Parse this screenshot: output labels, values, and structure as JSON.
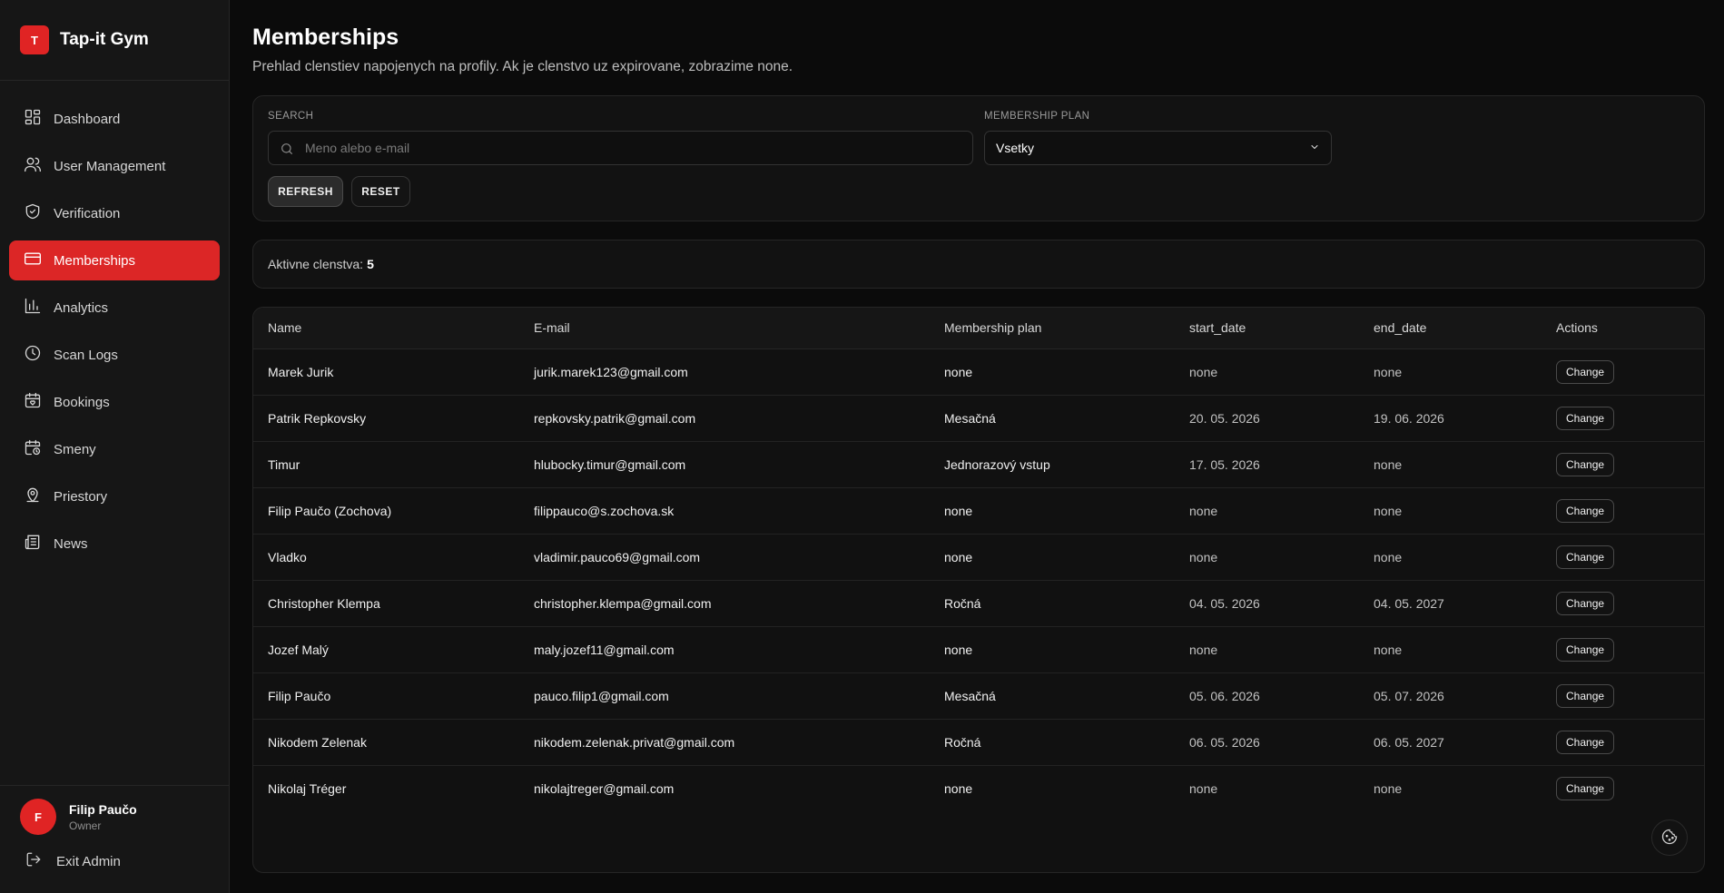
{
  "brand": {
    "logo_letter": "T",
    "name": "Tap-it Gym",
    "accent": "#dc2626"
  },
  "nav": [
    {
      "label": "Dashboard",
      "icon": "dashboard-icon"
    },
    {
      "label": "User Management",
      "icon": "users-icon"
    },
    {
      "label": "Verification",
      "icon": "shield-check-icon"
    },
    {
      "label": "Memberships",
      "icon": "credit-card-icon",
      "active": true
    },
    {
      "label": "Analytics",
      "icon": "bar-chart-icon"
    },
    {
      "label": "Scan Logs",
      "icon": "clock-icon"
    },
    {
      "label": "Bookings",
      "icon": "calendar-heart-icon"
    },
    {
      "label": "Smeny",
      "icon": "calendar-clock-icon"
    },
    {
      "label": "Priestory",
      "icon": "map-pin-icon"
    },
    {
      "label": "News",
      "icon": "newspaper-icon"
    }
  ],
  "user": {
    "avatar_letter": "F",
    "name": "Filip Paučo",
    "role": "Owner"
  },
  "exit_label": "Exit Admin",
  "page": {
    "title": "Memberships",
    "subtitle": "Prehlad clenstiev napojenych na profily. Ak je clenstvo uz expirovane, zobrazime none."
  },
  "filters": {
    "search_label": "SEARCH",
    "search_placeholder": "Meno alebo e-mail",
    "search_value": "",
    "plan_label": "MEMBERSHIP PLAN",
    "plan_value": "Vsetky",
    "refresh_label": "REFRESH",
    "reset_label": "RESET"
  },
  "stats": {
    "label": "Aktivne clenstva:",
    "value": "5"
  },
  "table": {
    "columns": [
      "Name",
      "E-mail",
      "Membership plan",
      "start_date",
      "end_date",
      "Actions"
    ],
    "action_label": "Change",
    "rows": [
      {
        "name": "Marek Jurik",
        "email": "jurik.marek123@gmail.com",
        "plan": "none",
        "start": "none",
        "end": "none"
      },
      {
        "name": "Patrik Repkovsky",
        "email": "repkovsky.patrik@gmail.com",
        "plan": "Mesačná",
        "start": "20. 05. 2026",
        "end": "19. 06. 2026"
      },
      {
        "name": "Timur",
        "email": "hlubocky.timur@gmail.com",
        "plan": "Jednorazový vstup",
        "start": "17. 05. 2026",
        "end": "none"
      },
      {
        "name": "Filip Paučo (Zochova)",
        "email": "filippauco@s.zochova.sk",
        "plan": "none",
        "start": "none",
        "end": "none"
      },
      {
        "name": "Vladko",
        "email": "vladimir.pauco69@gmail.com",
        "plan": "none",
        "start": "none",
        "end": "none"
      },
      {
        "name": "Christopher Klempa",
        "email": "christopher.klempa@gmail.com",
        "plan": "Ročná",
        "start": "04. 05. 2026",
        "end": "04. 05. 2027"
      },
      {
        "name": "Jozef Malý",
        "email": "maly.jozef11@gmail.com",
        "plan": "none",
        "start": "none",
        "end": "none"
      },
      {
        "name": "Filip Paučo",
        "email": "pauco.filip1@gmail.com",
        "plan": "Mesačná",
        "start": "05. 06. 2026",
        "end": "05. 07. 2026"
      },
      {
        "name": "Nikodem Zelenak",
        "email": "nikodem.zelenak.privat@gmail.com",
        "plan": "Ročná",
        "start": "06. 05. 2026",
        "end": "06. 05. 2027"
      },
      {
        "name": "Nikolaj Tréger",
        "email": "nikolajtreger@gmail.com",
        "plan": "none",
        "start": "none",
        "end": "none"
      }
    ]
  },
  "cookie_icon": "cookie-icon"
}
